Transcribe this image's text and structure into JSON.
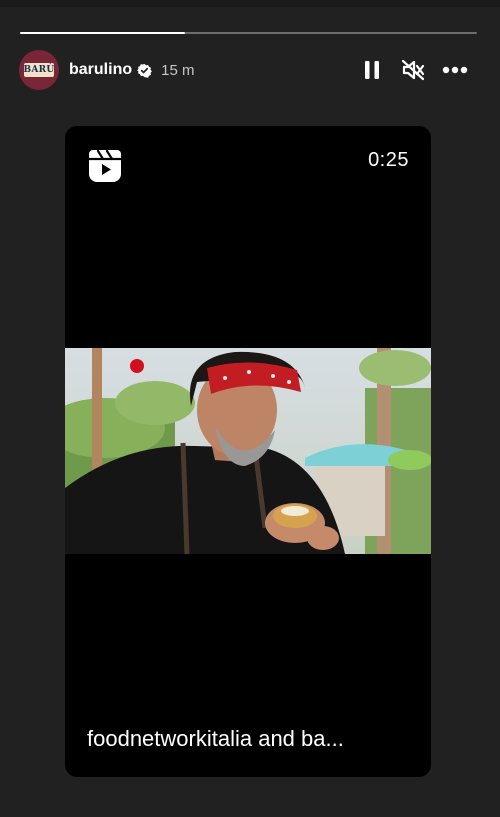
{
  "story": {
    "progress_fraction": 0.36,
    "header": {
      "avatar_text": "BARÙ",
      "username": "barulino",
      "verified": true,
      "timestamp": "15 m"
    },
    "controls": {
      "pause_icon": "pause-icon",
      "mute_icon": "mute-icon",
      "more_icon": "more-icon"
    },
    "post": {
      "reels_icon": "reels-icon",
      "duration": "0:25",
      "caption": "foodnetworkitalia and ba..."
    }
  },
  "colors": {
    "background": "#212121",
    "card": "#000000",
    "avatar": "#7b2538",
    "accent_red": "#d0101c"
  }
}
